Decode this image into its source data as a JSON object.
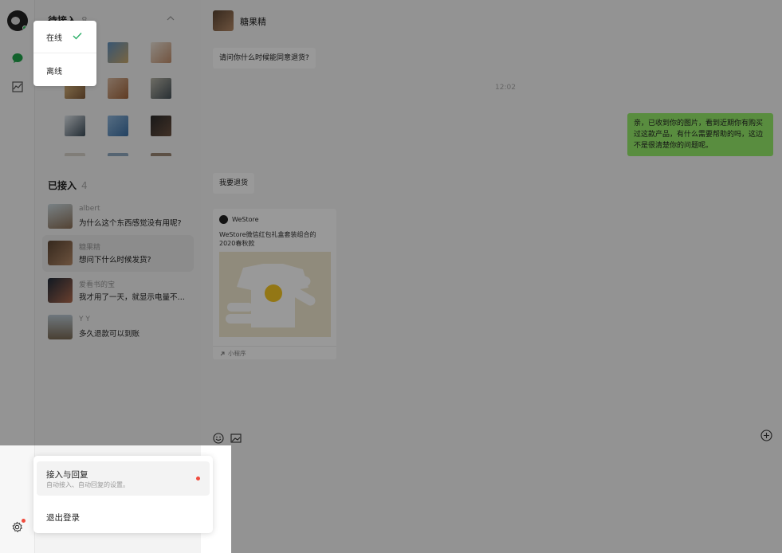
{
  "colors": {
    "accent_green": "#95ec69",
    "online_green": "#33c060",
    "badge_red": "#f04c3e"
  },
  "sidebar": {
    "icons": [
      "chat-bubble-icon",
      "chart-icon",
      "settings-icon"
    ]
  },
  "waiting_section": {
    "title": "待接入",
    "count": "8"
  },
  "status_menu": {
    "online": "在线",
    "offline": "离线"
  },
  "joined_section": {
    "title": "已接入",
    "count": "4"
  },
  "conversations": [
    {
      "name": "albert",
      "message": "为什么这个东西感觉没有用呢?"
    },
    {
      "name": "糖果精",
      "message": "想问下什么时候发货?"
    },
    {
      "name": "爱看书的宝",
      "message": "我才用了一天，就显示电量不足了"
    },
    {
      "name": "Y Y",
      "message": "多久退款可以到账"
    }
  ],
  "chat": {
    "title": "糖果精",
    "messages": {
      "m1": "请问你什么时候能同意退货?",
      "time": "12:02",
      "me": "亲，已收到你的图片，看到近期你有购买过这款产品，有什么需要帮助的吗，这边不是很清楚你的问题呢。",
      "m2": "我要退货"
    },
    "card": {
      "brand": "WeStore",
      "desc": "WeStore微信红包礼盒套装组合的2020春秋款",
      "footer": "小程序"
    }
  },
  "settings_menu": {
    "option1_title": "接入与回复",
    "option1_sub": "自动接入、自动回复的设置。",
    "option2": "退出登录"
  }
}
